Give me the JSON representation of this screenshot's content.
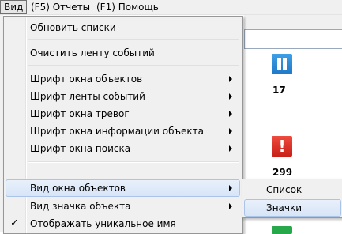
{
  "menubar": {
    "items": [
      "Вид",
      "(F5) Отчеты",
      "(F1) Помощь"
    ]
  },
  "background": {
    "objects": [
      {
        "icon": "pause-icon",
        "count": "17"
      },
      {
        "icon": "alarm-icon",
        "glyph": "!",
        "count": "299"
      },
      {
        "icon": "green-status-icon"
      }
    ]
  },
  "view_menu": {
    "items": [
      {
        "label": "Обновить списки"
      },
      {
        "label": "Очистить ленту событий"
      },
      {
        "label": "Шрифт окна объектов"
      },
      {
        "label": "Шрифт ленты событий"
      },
      {
        "label": "Шрифт окна тревог"
      },
      {
        "label": "Шрифт окна информации объекта"
      },
      {
        "label": "Шрифт окна поиска"
      },
      {
        "label": "Вид окна объектов"
      },
      {
        "label": "Вид значка объекта"
      },
      {
        "label": "Отображать уникальное имя",
        "check": "✓"
      }
    ]
  },
  "submenu": {
    "items": [
      {
        "label": "Список"
      },
      {
        "label": "Значки"
      }
    ]
  }
}
